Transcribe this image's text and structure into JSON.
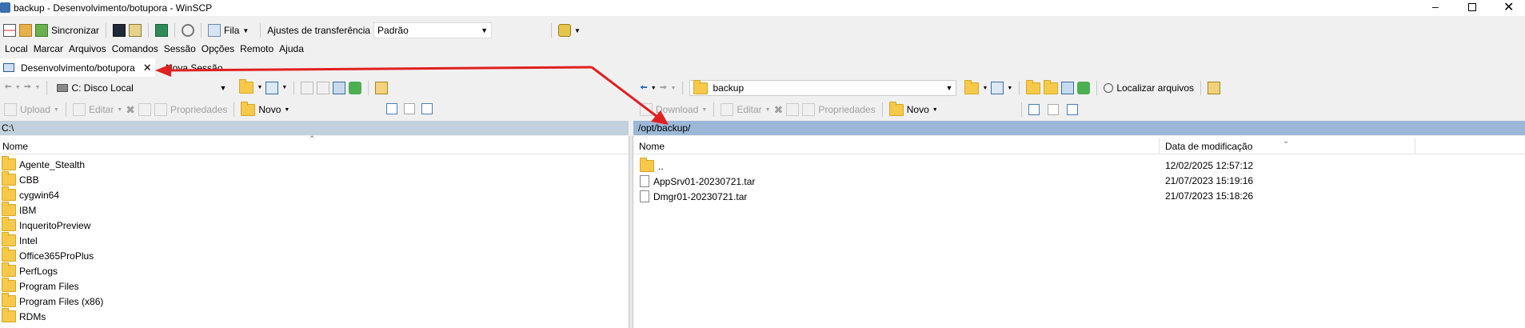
{
  "window": {
    "title": "backup - Desenvolvimento/botupora - WinSCP"
  },
  "toolbar1": {
    "sync_label": "Sincronizar",
    "queue_label": "Fila",
    "transfer_label": "Ajustes de transferência",
    "transfer_value": "Padrão"
  },
  "menu": [
    "Local",
    "Marcar",
    "Arquivos",
    "Comandos",
    "Sessão",
    "Opções",
    "Remoto",
    "Ajuda"
  ],
  "tabs": {
    "active": "Desenvolvimento/botupora",
    "new": "Nova Sessão"
  },
  "left": {
    "drive": "C: Disco Local",
    "upload": "Upload",
    "edit": "Editar",
    "props": "Propriedades",
    "new": "Novo",
    "path": "C:\\",
    "col_name": "Nome",
    "items": [
      "Agente_Stealth",
      "CBB",
      "cygwin64",
      "IBM",
      "InqueritoPreview",
      "Intel",
      "Office365ProPlus",
      "PerfLogs",
      "Program Files",
      "Program Files (x86)",
      "RDMs"
    ]
  },
  "right": {
    "folder": "backup",
    "find": "Localizar arquivos",
    "download": "Download",
    "edit": "Editar",
    "props": "Propriedades",
    "new": "Novo",
    "path": "/opt/backup/",
    "col_name": "Nome",
    "col_date": "Data de modificação",
    "items": [
      {
        "name": "..",
        "date": "12/02/2025 12:57:12"
      },
      {
        "name": "AppSrv01-20230721.tar",
        "date": "21/07/2023 15:19:16"
      },
      {
        "name": "Dmgr01-20230721.tar",
        "date": "21/07/2023 15:18:26"
      }
    ]
  },
  "colors": {
    "path_active": "#9cb8d8",
    "path_inactive": "#c3d0de",
    "arrow": "#e02020"
  }
}
